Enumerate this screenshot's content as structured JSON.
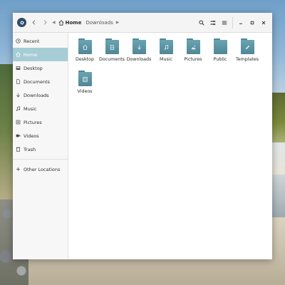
{
  "window": {
    "breadcrumb_current": "Home",
    "breadcrumb_next": "Downloads"
  },
  "sidebar": {
    "items": [
      {
        "label": "Recent",
        "icon": "clock-icon"
      },
      {
        "label": "Home",
        "icon": "home-icon",
        "active": true
      },
      {
        "label": "Desktop",
        "icon": "desktop-icon"
      },
      {
        "label": "Documents",
        "icon": "document-icon"
      },
      {
        "label": "Downloads",
        "icon": "download-arrow-icon"
      },
      {
        "label": "Music",
        "icon": "music-note-icon"
      },
      {
        "label": "Pictures",
        "icon": "picture-icon"
      },
      {
        "label": "Videos",
        "icon": "video-icon"
      },
      {
        "label": "Trash",
        "icon": "trash-icon"
      }
    ],
    "other_locations": "Other Locations"
  },
  "folders": [
    {
      "label": "Desktop",
      "icon": "home-icon"
    },
    {
      "label": "Documents",
      "icon": "document-icon"
    },
    {
      "label": "Downloads",
      "icon": "download-arrow-icon"
    },
    {
      "label": "Music",
      "icon": "music-note-icon"
    },
    {
      "label": "Pictures",
      "icon": "picture-icon"
    },
    {
      "label": "Public",
      "icon": "none"
    },
    {
      "label": "Templates",
      "icon": "pencil-icon"
    },
    {
      "label": "Videos",
      "icon": "video-icon"
    }
  ],
  "colors": {
    "accent": "#a6cdd6",
    "folder": "#5a95a4"
  }
}
